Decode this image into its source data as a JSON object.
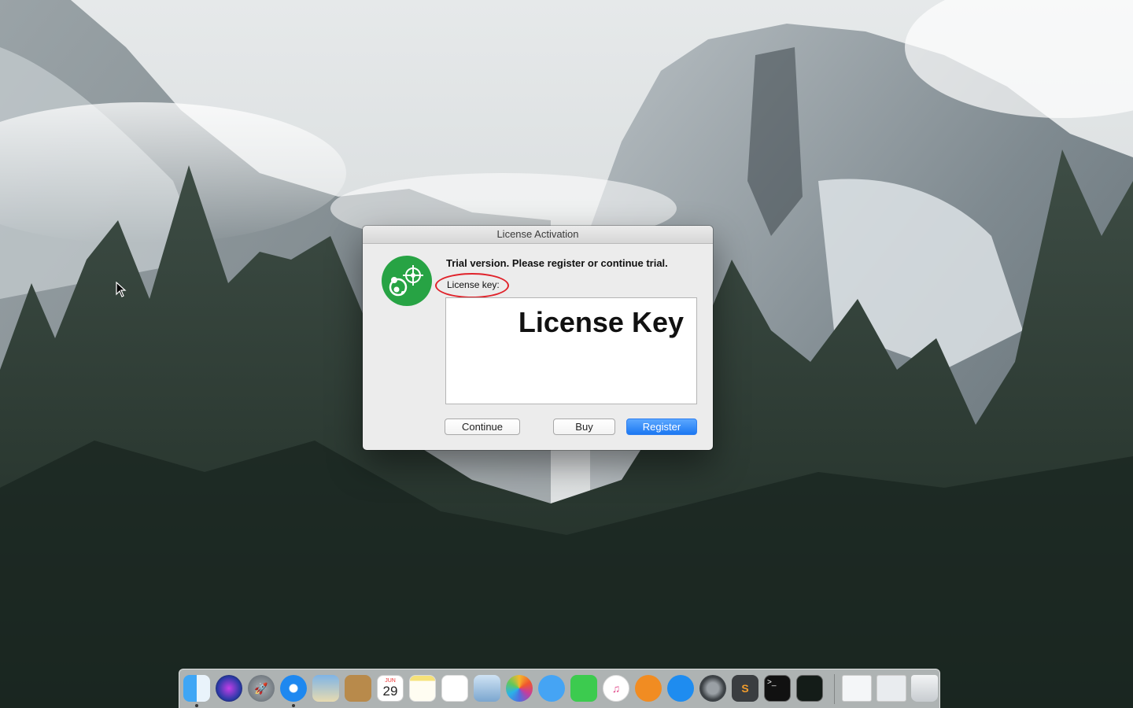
{
  "dialog": {
    "title": "License Activation",
    "headline": "Trial version. Please register or continue trial.",
    "key_label": "License key:",
    "key_value": "License Key",
    "buttons": {
      "continue": "Continue",
      "buy": "Buy",
      "register": "Register"
    },
    "accent_color": "#1c78f2",
    "icon_color": "#27a344",
    "annotation_color": "#e0222a"
  },
  "dock": {
    "calendar_month": "JUN",
    "calendar_day": "29",
    "items": [
      "finder-icon",
      "siri-icon",
      "launchpad-icon",
      "safari-icon",
      "mail-icon",
      "contacts-icon",
      "calendar-icon",
      "notes-icon",
      "reminders-icon",
      "preview-icon",
      "photos-icon",
      "messages-icon",
      "facetime-icon",
      "itunes-icon",
      "ibooks-icon",
      "app-store-icon",
      "system-preferences-icon",
      "sublime-text-icon",
      "terminal-icon",
      "activity-monitor-icon",
      "documents-folder-icon",
      "downloads-folder-icon",
      "trash-icon"
    ]
  }
}
